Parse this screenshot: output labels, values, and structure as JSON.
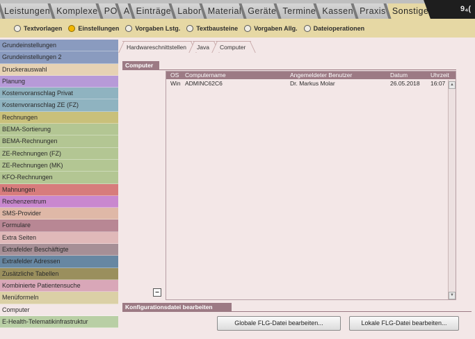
{
  "top_tabs": [
    {
      "label": "Leistungen",
      "color": "#c6c6c6"
    },
    {
      "label": "Komplexe",
      "color": "#c6c6c6"
    },
    {
      "label": "PO",
      "color": "#c6c6c6"
    },
    {
      "label": "A",
      "color": "#c6c6c6"
    },
    {
      "label": "Einträge",
      "color": "#c6c6c6"
    },
    {
      "label": "Labor",
      "color": "#c6c6c6"
    },
    {
      "label": "Material",
      "color": "#c6c6c6"
    },
    {
      "label": "Geräte",
      "color": "#c6c6c6"
    },
    {
      "label": "Termine",
      "color": "#c6c6c6"
    },
    {
      "label": "Kassen",
      "color": "#c6c6c6"
    },
    {
      "label": "Praxis",
      "color": "#c6c6c6"
    },
    {
      "label": "Sonstiges",
      "color": "#e6d8a4"
    }
  ],
  "corner_label": "9₄(",
  "radio_options": [
    {
      "label": "Textvorlagen",
      "selected": false
    },
    {
      "label": "Einstellungen",
      "selected": true
    },
    {
      "label": "Vorgaben Lstg.",
      "selected": false
    },
    {
      "label": "Textbausteine",
      "selected": false
    },
    {
      "label": "Vorgaben Allg.",
      "selected": false
    },
    {
      "label": "Dateioperationen",
      "selected": false
    }
  ],
  "sidebar": {
    "items": [
      {
        "label": "Grundeinstellungen",
        "color": "#8a9bbf"
      },
      {
        "label": "Grundeinstellungen 2",
        "color": "#8a9bbf"
      },
      {
        "label": "Druckerauswahl",
        "color": "#e6d2b4"
      },
      {
        "label": "Planung",
        "color": "#b79ad8"
      },
      {
        "label": "Kostenvoranschlag Privat",
        "color": "#8fb3c0"
      },
      {
        "label": "Kostenvoranschlag ZE (FZ)",
        "color": "#8fb3c0"
      },
      {
        "label": "Rechnungen",
        "color": "#c9c07a"
      },
      {
        "label": "BEMA-Sortierung",
        "color": "#b3c693"
      },
      {
        "label": "BEMA-Rechnungen",
        "color": "#b3c693"
      },
      {
        "label": "ZE-Rechnungen (FZ)",
        "color": "#b3c693"
      },
      {
        "label": "ZE-Rechnungen (MK)",
        "color": "#b3c693"
      },
      {
        "label": "KFO-Rechnungen",
        "color": "#b3c693"
      },
      {
        "label": "Mahnungen",
        "color": "#d77c7c"
      },
      {
        "label": "Rechenzentrum",
        "color": "#c988cf"
      },
      {
        "label": "SMS-Provider",
        "color": "#dfb8a7"
      },
      {
        "label": "Formulare",
        "color": "#b88794"
      },
      {
        "label": "Extra Seiten",
        "color": "#e0b9b9"
      },
      {
        "label": "Extrafelder Beschäftigte",
        "color": "#a68f96"
      },
      {
        "label": "Extrafelder Adressen",
        "color": "#6787a2"
      },
      {
        "label": "Zusätzliche Tabellen",
        "color": "#9a8f5d"
      },
      {
        "label": "Kombinierte Patientensuche",
        "color": "#d9a7b8"
      },
      {
        "label": "Menüformeln",
        "color": "#dbd0a6"
      },
      {
        "label": "Computer",
        "color": "#f3e7e7"
      },
      {
        "label": "E-Health-Telematikinfrastruktur",
        "color": "#b9cfa5"
      }
    ]
  },
  "subtabs": [
    "Hardwareschnittstellen",
    "Java",
    "Computer"
  ],
  "computer_section": {
    "title": "Computer",
    "columns": [
      "OS",
      "Computername",
      "Angemeldeter Benutzer",
      "Datum",
      "Uhrzeit"
    ],
    "rows": [
      {
        "os": "Win",
        "name": "ADMINC62C6",
        "user": "Dr. Markus Molar",
        "date": "26.05.2018",
        "time": "16:07"
      }
    ],
    "remove_label": "–"
  },
  "config_section": {
    "title": "Konfigurationsdatei bearbeiten",
    "global_button": "Globale FLG-Datei bearbeiten...",
    "local_button": "Lokale FLG-Datei bearbeiten..."
  },
  "colors": {
    "header": "#9c7a84",
    "panel_bg": "#f3e7e7",
    "radio_bar": "#e6d8a4",
    "radio_selected": "#f2b600"
  }
}
